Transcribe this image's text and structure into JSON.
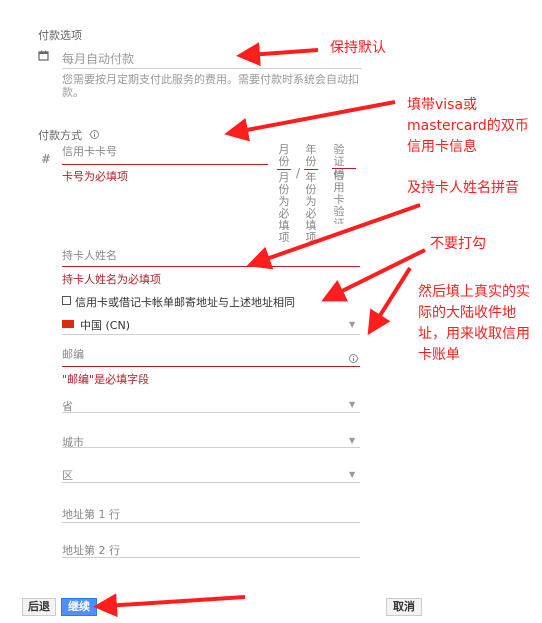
{
  "payment_option": {
    "label": "付款选项",
    "value": "每月自动付款",
    "description": "您需要按月定期支付此服务的费用。需要付款时系统会自动扣款。"
  },
  "payment_method": {
    "label": "付款方式",
    "card_number_label": "信用卡卡号",
    "card_number_error": "卡号为必填项",
    "month_label": "月份",
    "month_error": "月份为必填项",
    "separator": "/",
    "year_label": "年份",
    "year_error": "年份为必填项",
    "cvc_label": "验证码",
    "cvc_error": "信用卡验证码为必填项",
    "cardholder_label": "持卡人姓名",
    "cardholder_error": "持卡人姓名为必填项",
    "same_address_label": "信用卡或借记卡帐单邮寄地址与上述地址相同",
    "country_value": "中国 (CN)",
    "postal_label": "邮编",
    "postal_error": "\"邮编\"是必填字段",
    "province_label": "省",
    "city_label": "城市",
    "district_label": "区",
    "address1_label": "地址第 1 行",
    "address2_label": "地址第 2 行"
  },
  "buttons": {
    "back": "后退",
    "continue": "继续",
    "cancel": "取消"
  },
  "annotations": {
    "keep_default": "保持默认",
    "fill_card": "填带visa或mastercard的双币信用卡信息",
    "cardholder_pinyin": "及持卡人姓名拼音",
    "no_check": "不要打勾",
    "real_address": "然后填上真实的实际的大陆收件地址，用来收取信用卡账单"
  },
  "colors": {
    "error": "#b3202a",
    "annotation": "#ff1e1e",
    "primary_button": "#4d90fe"
  },
  "icons": {
    "calendar": "calendar-icon",
    "info": "info-icon",
    "hash": "hash-icon",
    "flag": "china-flag-icon"
  }
}
